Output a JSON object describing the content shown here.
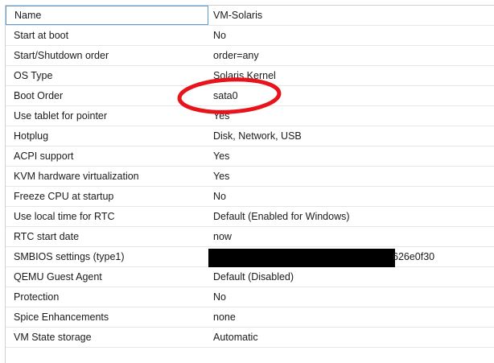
{
  "rows": [
    {
      "key": "Name",
      "value": "VM-Solaris"
    },
    {
      "key": "Start at boot",
      "value": "No"
    },
    {
      "key": "Start/Shutdown order",
      "value": "order=any"
    },
    {
      "key": "OS Type",
      "value": "Solaris Kernel"
    },
    {
      "key": "Boot Order",
      "value": "sata0"
    },
    {
      "key": "Use tablet for pointer",
      "value": "Yes"
    },
    {
      "key": "Hotplug",
      "value": "Disk, Network, USB"
    },
    {
      "key": "ACPI support",
      "value": "Yes"
    },
    {
      "key": "KVM hardware virtualization",
      "value": "Yes"
    },
    {
      "key": "Freeze CPU at startup",
      "value": "No"
    },
    {
      "key": "Use local time for RTC",
      "value": "Default (Enabled for Windows)"
    },
    {
      "key": "RTC start date",
      "value": "now"
    },
    {
      "key": "SMBIOS settings (type1)",
      "value": "626e0f30"
    },
    {
      "key": "QEMU Guest Agent",
      "value": "Default (Disabled)"
    },
    {
      "key": "Protection",
      "value": "No"
    },
    {
      "key": "Spice Enhancements",
      "value": "none"
    },
    {
      "key": "VM State storage",
      "value": "Automatic"
    }
  ],
  "annotation": {
    "color": "#e8141b"
  },
  "redaction": {
    "color": "#000000"
  }
}
